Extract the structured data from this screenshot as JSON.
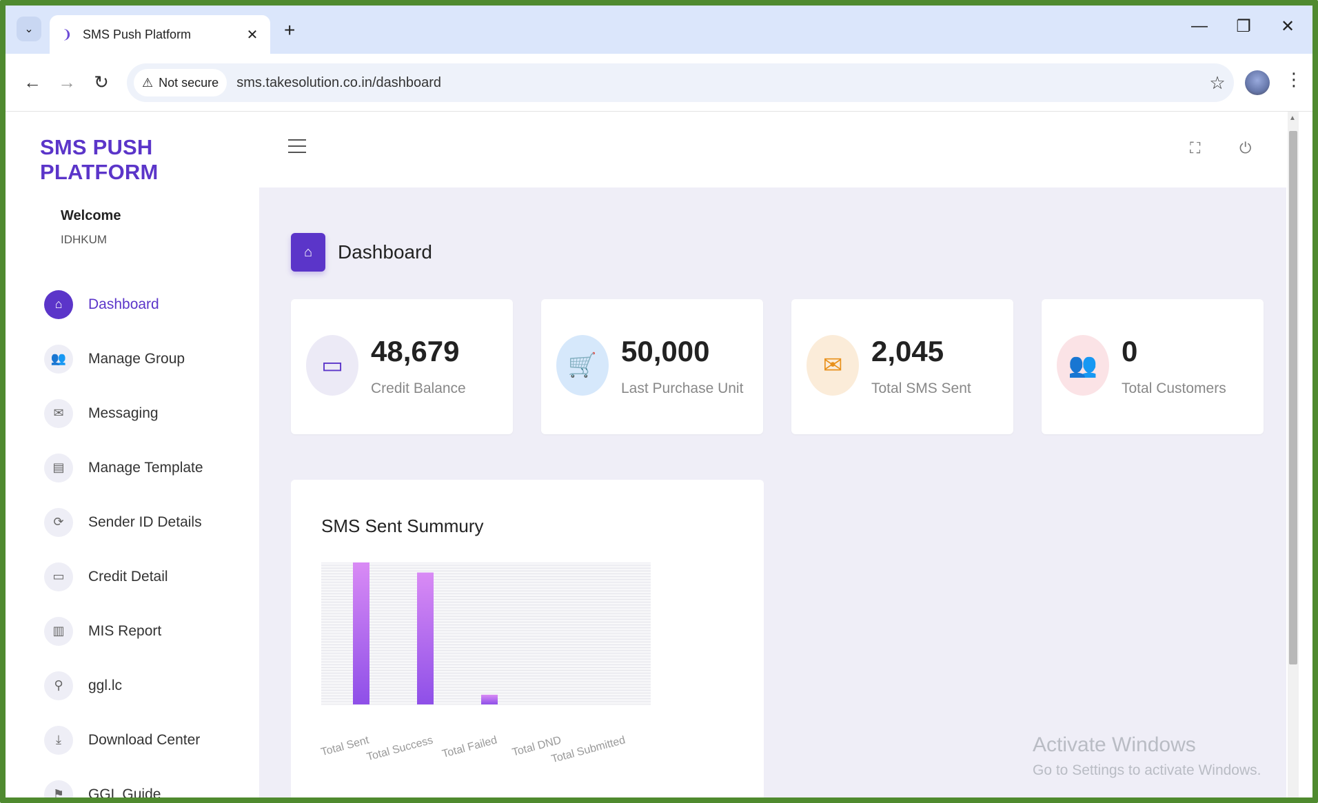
{
  "browser": {
    "tab_title": "SMS Push Platform",
    "tab_close": "✕",
    "new_tab": "+",
    "security_label": "Not secure",
    "url": "sms.takesolution.co.in/dashboard",
    "minimize": "—",
    "restore": "❐",
    "close": "✕"
  },
  "app": {
    "brand": "SMS PUSH PLATFORM",
    "welcome": "Welcome",
    "username": "IDHKUM"
  },
  "sidebar": {
    "items": [
      {
        "label": "Dashboard",
        "icon": "home-icon",
        "glyph": "⌂",
        "active": true
      },
      {
        "label": "Manage Group",
        "icon": "group-icon",
        "glyph": "👥",
        "active": false
      },
      {
        "label": "Messaging",
        "icon": "envelope-icon",
        "glyph": "✉",
        "active": false
      },
      {
        "label": "Manage Template",
        "icon": "template-icon",
        "glyph": "▤",
        "active": false
      },
      {
        "label": "Sender ID Details",
        "icon": "sender-id-icon",
        "glyph": "⟳",
        "active": false
      },
      {
        "label": "Credit Detail",
        "icon": "credit-card-icon",
        "glyph": "▭",
        "active": false
      },
      {
        "label": "MIS Report",
        "icon": "bar-chart-icon",
        "glyph": "▥",
        "active": false
      },
      {
        "label": "ggl.lc",
        "icon": "pin-icon",
        "glyph": "⚲",
        "active": false
      },
      {
        "label": "Download Center",
        "icon": "download-icon",
        "glyph": "⤓",
        "active": false
      },
      {
        "label": "GGL Guide",
        "icon": "guide-icon",
        "glyph": "⚑",
        "active": false
      }
    ]
  },
  "page": {
    "title": "Dashboard"
  },
  "cards": [
    {
      "value": "48,679",
      "label": "Credit Balance",
      "icon": "credit-card-icon",
      "glyph": "▭",
      "bg": "#eceaf6",
      "fg": "#5b35c9"
    },
    {
      "value": "50,000",
      "label": "Last Purchase Unit",
      "icon": "cart-icon",
      "glyph": "🛒",
      "bg": "#d6e8fb",
      "fg": "#2f7fd6"
    },
    {
      "value": "2,045",
      "label": "Total SMS Sent",
      "icon": "open-envelope-icon",
      "glyph": "✉",
      "bg": "#fbecd9",
      "fg": "#e8901a"
    },
    {
      "value": "0",
      "label": "Total Customers",
      "icon": "customers-icon",
      "glyph": "👥",
      "bg": "#fbe3e6",
      "fg": "#e0344e"
    }
  ],
  "chart": {
    "title": "SMS Sent Summury"
  },
  "chart_data": {
    "type": "bar",
    "categories": [
      "Total Sent",
      "Total Success",
      "Total Failed",
      "Total DND",
      "Total Submitted"
    ],
    "values": [
      2045,
      1900,
      140,
      0,
      0
    ],
    "ylim": [
      0,
      2045
    ],
    "title": "SMS Sent Summury",
    "xlabel": "",
    "ylabel": "",
    "grid": true,
    "bar_color_top": "#d98bf5",
    "bar_color_bottom": "#8e4fe8"
  },
  "watermark": {
    "title": "Activate Windows",
    "subtitle": "Go to Settings to activate Windows."
  },
  "colors": {
    "accent": "#5b35c9",
    "background": "#efeef7"
  }
}
